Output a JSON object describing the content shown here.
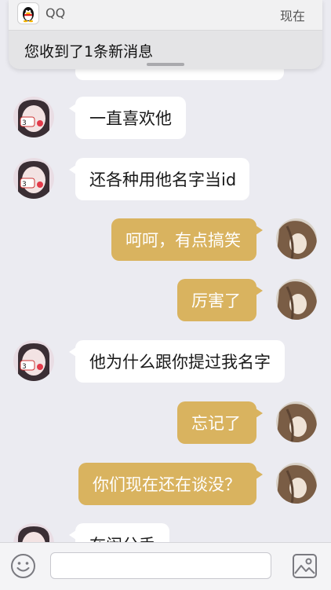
{
  "notification": {
    "app_name": "QQ",
    "time": "现在",
    "message": "您收到了1条新消息"
  },
  "messages": [
    {
      "side": "left",
      "text": "一直喜欢他"
    },
    {
      "side": "left",
      "text": "还各种用他名字当id"
    },
    {
      "side": "right",
      "text": "呵呵，有点搞笑"
    },
    {
      "side": "right",
      "text": "厉害了"
    },
    {
      "side": "left",
      "text": "他为什么跟你提过我名字"
    },
    {
      "side": "right",
      "text": "忘记了"
    },
    {
      "side": "right",
      "text": "你们现在还在谈没？"
    },
    {
      "side": "left",
      "text": "在闹分手"
    }
  ],
  "input": {
    "placeholder": "",
    "value": ""
  },
  "icons": {
    "emoji": "smiley-face-icon",
    "image": "image-picker-icon",
    "app": "qq-penguin-icon"
  },
  "colors": {
    "accent_bubble": "#d9b35f",
    "background": "#ebebf1"
  }
}
